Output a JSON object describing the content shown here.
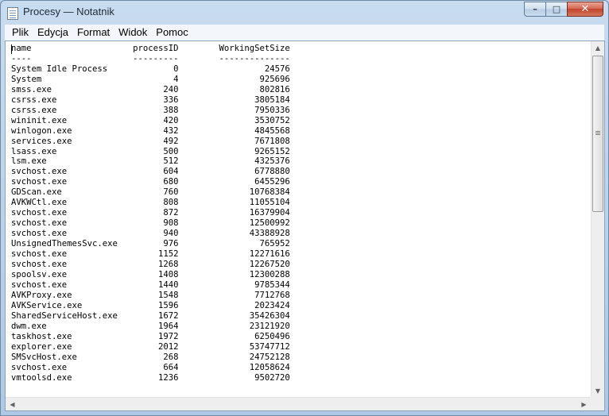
{
  "window": {
    "title": "Procesy — Notatnik",
    "minimize_symbol": "–",
    "maximize_symbol": "□",
    "close_symbol": "✕"
  },
  "menu": {
    "items": [
      "Plik",
      "Edycja",
      "Format",
      "Widok",
      "Pomoc"
    ]
  },
  "document": {
    "lines": [
      "name                    processID        WorkingSetSize",
      "----                    ---------        --------------",
      "System Idle Process             0                 24576",
      "System                          4                925696",
      "smss.exe                      240                802816",
      "csrss.exe                     336               3805184",
      "csrss.exe                     388               7950336",
      "wininit.exe                   420               3530752",
      "winlogon.exe                  432               4845568",
      "services.exe                  492               7671808",
      "lsass.exe                     500               9265152",
      "lsm.exe                       512               4325376",
      "svchost.exe                   604               6778880",
      "svchost.exe                   680               6455296",
      "GDScan.exe                    760              10768384",
      "AVKWCtl.exe                   808              11055104",
      "svchost.exe                   872              16379904",
      "svchost.exe                   908              12500992",
      "svchost.exe                   940              43388928",
      "UnsignedThemesSvc.exe         976                765952",
      "svchost.exe                  1152              12271616",
      "svchost.exe                  1268              12267520",
      "spoolsv.exe                  1408              12300288",
      "svchost.exe                  1440               9785344",
      "AVKProxy.exe                 1548               7712768",
      "AVKService.exe               1596               2023424",
      "SharedServiceHost.exe        1672              35426304",
      "dwm.exe                      1964              23121920",
      "taskhost.exe                 1972               6250496",
      "explorer.exe                 2012              53747712",
      "SMSvcHost.exe                 268              24752128",
      "svchost.exe                   664              12058624",
      "vmtoolsd.exe                 1236               9502720"
    ]
  },
  "scrollbars": {
    "up_arrow": "▲",
    "down_arrow": "▼",
    "left_arrow": "◀",
    "right_arrow": "▶"
  }
}
